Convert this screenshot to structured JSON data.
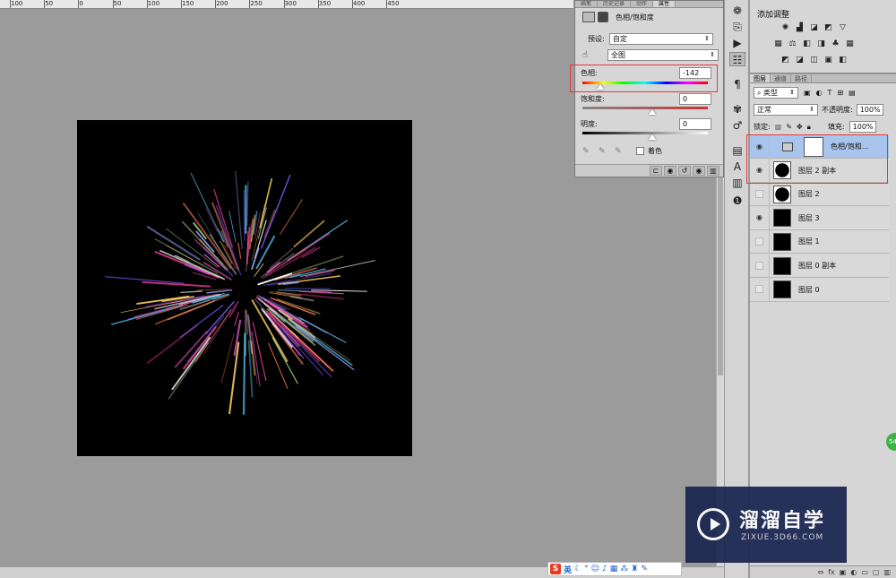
{
  "ruler": {
    "ticks": [
      "100",
      "50",
      "0",
      "50",
      "100",
      "150",
      "200",
      "250",
      "300",
      "350",
      "400",
      "450"
    ]
  },
  "properties_panel": {
    "tabs": [
      "画笔",
      "历史记录",
      "动作",
      "属性"
    ],
    "active_tab": "属性",
    "adjustment_title": "色相/饱和度",
    "preset_label": "预设:",
    "preset_value": "自定",
    "channel_value": "全图",
    "hue_label": "色相:",
    "hue_value": "-142",
    "saturation_label": "饱和度:",
    "saturation_value": "0",
    "lightness_label": "明度:",
    "lightness_value": "0",
    "colorize_label": "着色"
  },
  "adjustments_panel": {
    "title": "添加调整"
  },
  "layers_panel": {
    "tabs": [
      "图层",
      "通道",
      "路径"
    ],
    "active_tab": "图层",
    "filter_kind": "类型",
    "blend_mode": "正常",
    "opacity_label": "不透明度:",
    "opacity_value": "100%",
    "lock_label": "锁定:",
    "fill_label": "填充:",
    "fill_value": "100%",
    "layers": [
      {
        "name": "色相/饱和...",
        "visible": true,
        "selected": true
      },
      {
        "name": "图层 2 副本",
        "visible": true,
        "selected": false
      },
      {
        "name": "图层 2",
        "visible": false,
        "selected": false
      },
      {
        "name": "图层 3",
        "visible": true,
        "selected": false
      },
      {
        "name": "图层 1",
        "visible": false,
        "selected": false
      },
      {
        "name": "图层 0 副本",
        "visible": false,
        "selected": false
      },
      {
        "name": "图层 0",
        "visible": false,
        "selected": false
      }
    ],
    "bottom_icons": [
      "link-icon",
      "fx-icon",
      "mask-icon",
      "adjustment-icon",
      "folder-icon",
      "new-layer-icon",
      "trash-icon"
    ]
  },
  "watermark": {
    "title": "溜溜自学",
    "url": "ZIXUE.3D66.COM"
  },
  "ime_bar": {
    "lang": "英"
  },
  "badge": {
    "text": "54"
  }
}
